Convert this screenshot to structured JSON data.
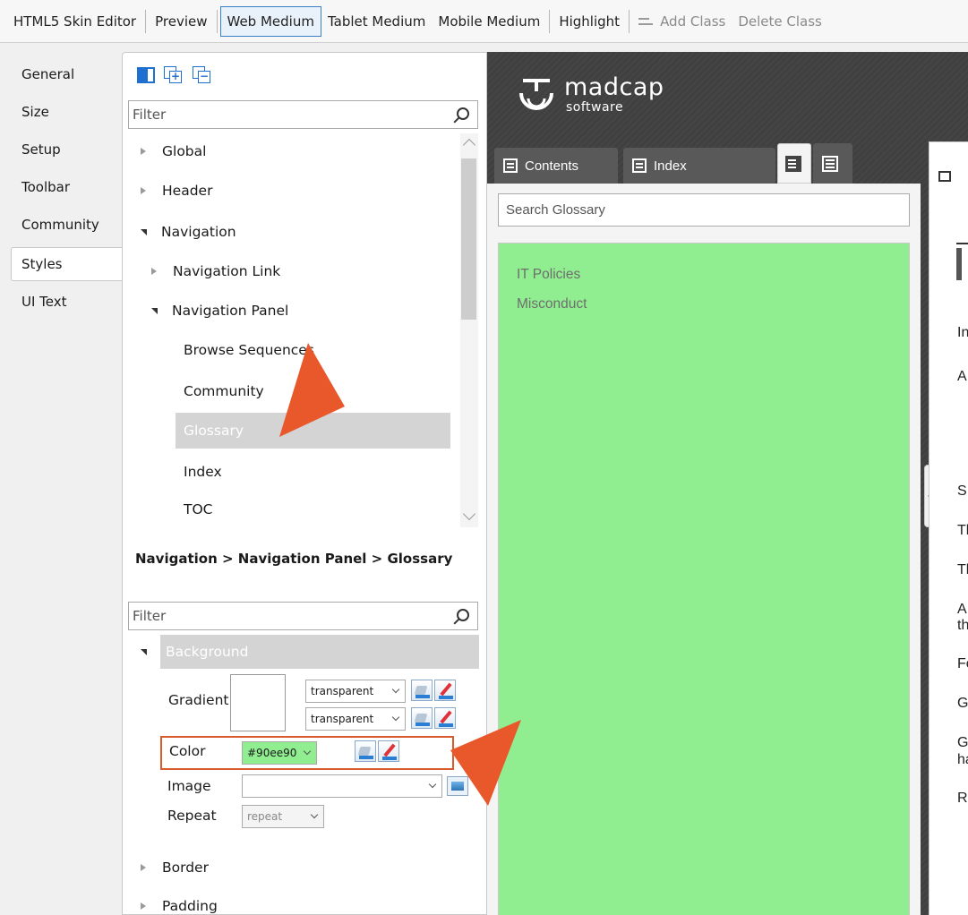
{
  "toolbar": {
    "items": [
      "HTML5 Skin Editor",
      "Preview",
      "Web Medium",
      "Tablet Medium",
      "Mobile Medium",
      "Highlight",
      "Add Class",
      "Delete Class"
    ]
  },
  "leftnav": {
    "items": [
      "General",
      "Size",
      "Setup",
      "Toolbar",
      "Community",
      "Styles",
      "UI Text"
    ],
    "active": "Styles"
  },
  "tree": {
    "filter_placeholder": "Filter",
    "rows": [
      {
        "label": "Global"
      },
      {
        "label": "Header"
      },
      {
        "label": "Navigation"
      },
      {
        "label": "Navigation Link"
      },
      {
        "label": "Navigation Panel"
      },
      {
        "label": "Browse Sequences"
      },
      {
        "label": "Community"
      },
      {
        "label": "Glossary"
      },
      {
        "label": "Index"
      },
      {
        "label": "TOC"
      }
    ],
    "selected": "Glossary"
  },
  "breadcrumb": "Navigation > Navigation Panel > Glossary",
  "props": {
    "filter_placeholder": "Filter",
    "section": "Background",
    "gradient_label": "Gradient",
    "gradient_top": "transparent",
    "gradient_bottom": "transparent",
    "color_label": "Color",
    "color_value": "#90ee90",
    "image_label": "Image",
    "image_value": "",
    "repeat_label": "Repeat",
    "repeat_value": "repeat",
    "border_label": "Border",
    "padding_label": "Padding"
  },
  "preview": {
    "logo_name": "madcap",
    "logo_sub": "software",
    "tabs": [
      "Contents",
      "Index"
    ],
    "search_placeholder": "Search Glossary",
    "terms": [
      "IT Policies",
      "Misconduct"
    ],
    "glossary_bg": "#90ee90",
    "topic_letters": [
      "In",
      "A",
      "S",
      "Th",
      "Th",
      "A",
      "th",
      "Fo",
      "G",
      "G",
      "ha",
      "R"
    ]
  },
  "colors": {
    "accent_border": "#3c7fc4",
    "highlight_box": "#d95a2b",
    "arrow": "#e8582a"
  }
}
